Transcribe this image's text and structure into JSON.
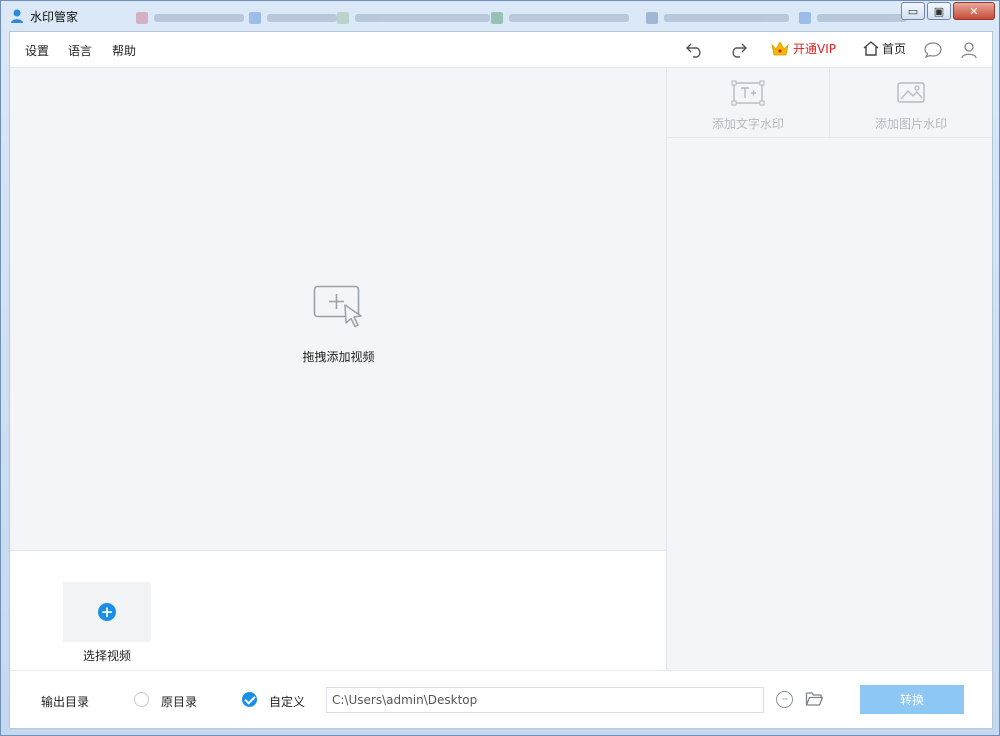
{
  "window": {
    "title": "水印管家",
    "minimize": "▭",
    "maximize": "▣",
    "close": "✕"
  },
  "menu": {
    "settings": "设置",
    "language": "语言",
    "help": "帮助"
  },
  "header": {
    "vip_label": "开通VIP",
    "home_label": "首页"
  },
  "drop_zone": {
    "label": "拖拽添加视频"
  },
  "thumbs": {
    "select_label": "选择视频",
    "plus": "+"
  },
  "watermark_tabs": {
    "text_label": "添加文字水印",
    "image_label": "添加图片水印"
  },
  "output": {
    "label": "输出目录",
    "option_original": "原目录",
    "option_custom": "自定义",
    "selected": "custom",
    "path": "C:\\Users\\admin\\Desktop",
    "more": "···",
    "convert_label": "转换"
  },
  "colors": {
    "accent": "#1a8fe8",
    "vip": "#e02020",
    "convert_disabled": "#8cc7f5"
  }
}
